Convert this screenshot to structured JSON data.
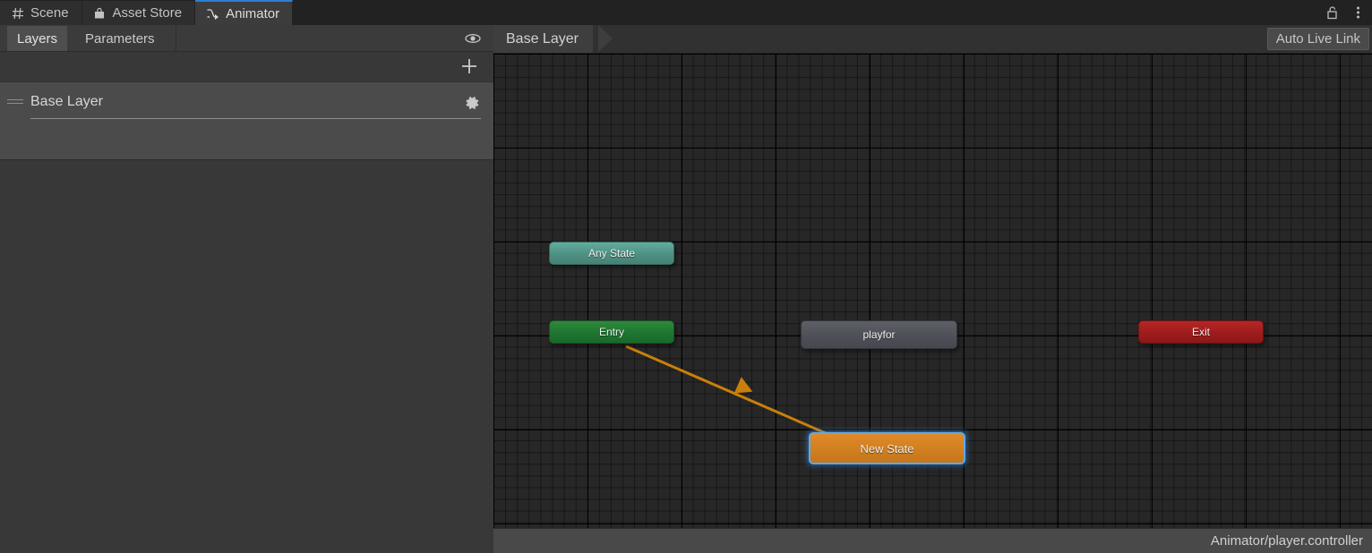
{
  "window": {
    "tabs": [
      {
        "label": "Scene",
        "icon": "grid-icon",
        "active": false
      },
      {
        "label": "Asset Store",
        "icon": "store-icon",
        "active": false
      },
      {
        "label": "Animator",
        "icon": "animator-icon",
        "active": true
      }
    ],
    "lock_icon": "lock-open-icon",
    "menu_icon": "kebab-menu-icon"
  },
  "left_panel": {
    "tabs": [
      {
        "label": "Layers",
        "selected": true
      },
      {
        "label": "Parameters",
        "selected": false
      }
    ],
    "visibility_icon": "eye-icon",
    "add_layer_icon": "plus-icon",
    "layers": [
      {
        "name": "Base Layer",
        "settings_icon": "gear-icon",
        "drag_icon": "drag-handle-icon"
      }
    ]
  },
  "graph": {
    "breadcrumb": "Base Layer",
    "live_link_label": "Auto Live Link",
    "nodes": [
      {
        "id": "any-state",
        "label": "Any State",
        "color": "#4e9083"
      },
      {
        "id": "entry",
        "label": "Entry",
        "color": "#1f7530"
      },
      {
        "id": "playfor",
        "label": "playfor",
        "color": "#4e5057"
      },
      {
        "id": "exit",
        "label": "Exit",
        "color": "#9e1c1c"
      },
      {
        "id": "new-state",
        "label": "New State",
        "color": "#d07f20",
        "selected": true,
        "outline": "#5fa9e8"
      }
    ],
    "transitions": [
      {
        "from": "entry",
        "to": "new-state",
        "color": "#c8800a"
      }
    ]
  },
  "status": {
    "path": "Animator/player.controller"
  }
}
